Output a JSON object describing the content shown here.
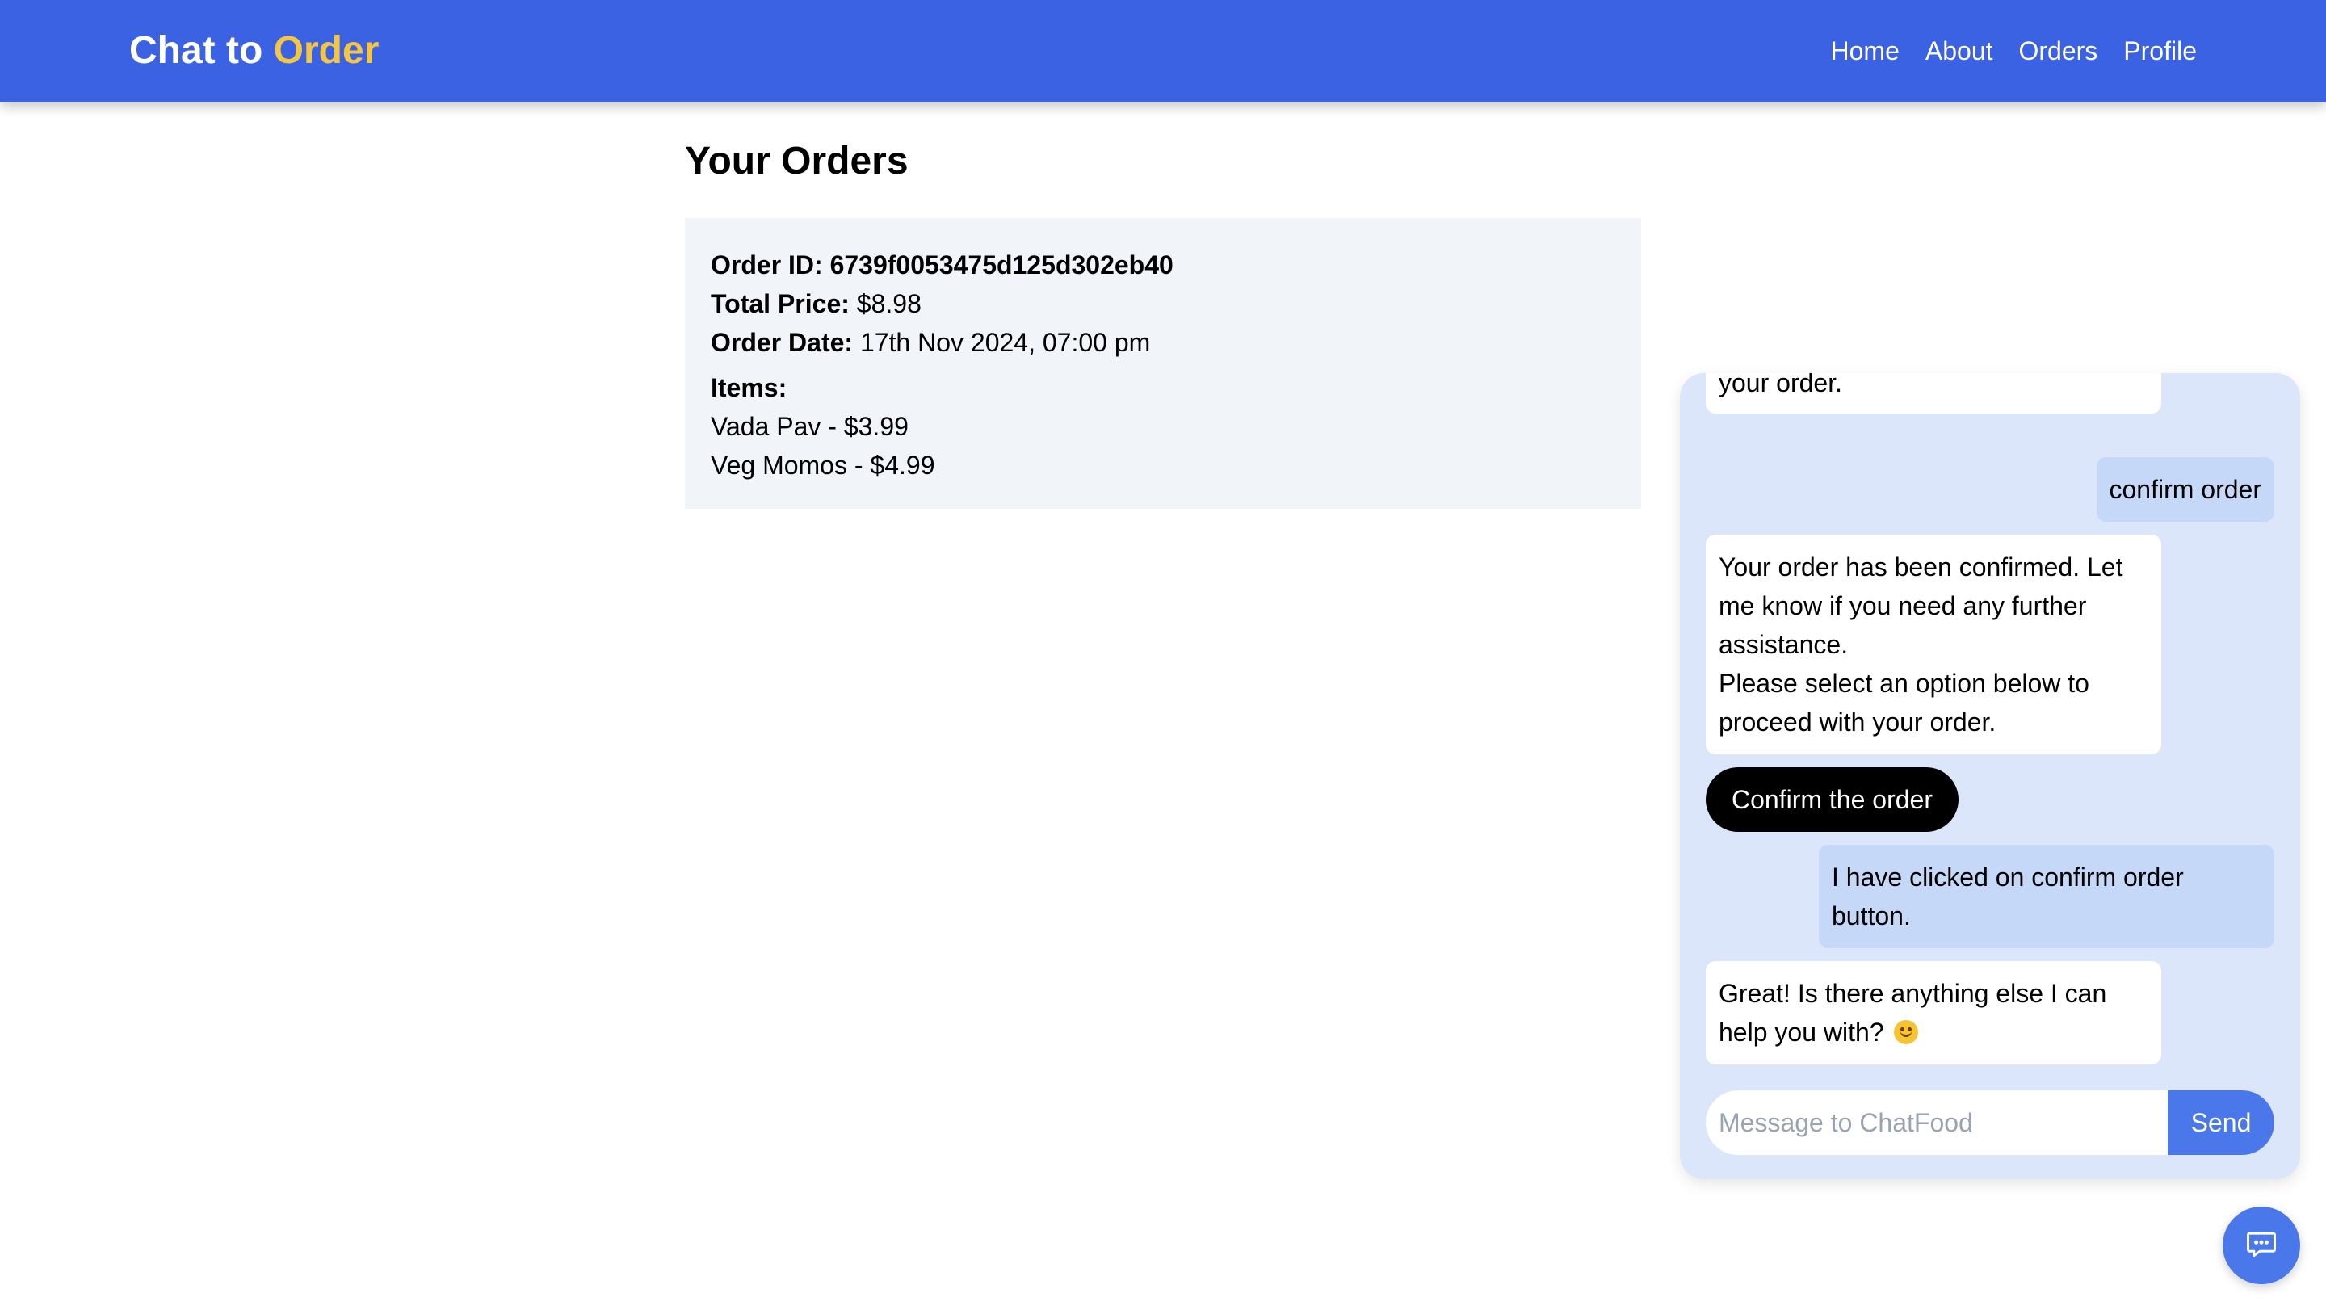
{
  "header": {
    "brand_part1": "Chat to",
    "brand_part2": "Order",
    "nav": {
      "home": "Home",
      "about": "About",
      "orders": "Orders",
      "profile": "Profile"
    }
  },
  "orders": {
    "title": "Your Orders",
    "list": [
      {
        "id_label": "Order ID:",
        "id_value": "6739f0053475d125d302eb40",
        "total_label": "Total Price:",
        "total_value": "$8.98",
        "date_label": "Order Date:",
        "date_value": "17th Nov 2024, 07:00 pm",
        "items_label": "Items:",
        "items": [
          "Vada Pav - $3.99",
          "Veg Momos - $4.99"
        ]
      }
    ]
  },
  "chat": {
    "messages": {
      "partial_bot": "your order.",
      "user_confirm": "confirm order",
      "bot_confirmed_1": "Your order has been confirmed. Let me know if you need any further assistance.",
      "bot_confirmed_2": "Please select an option below to proceed with your order.",
      "user_clicked": "I have clicked on confirm order button.",
      "bot_great": "Great! Is there anything else I can help you with?"
    },
    "option_button": "Confirm the order",
    "input_placeholder": "Message to ChatFood",
    "input_value": "",
    "send_label": "Send"
  },
  "colors": {
    "header_bg": "#3a62e3",
    "brand_accent": "#f4c542",
    "chat_panel_bg": "#dbe6fb",
    "user_bubble": "#c5d8f8",
    "send_button": "#4a78ea"
  },
  "icons": {
    "chat_toggle": "chat-bubble-icon",
    "emoji": "smiling-face-emoji"
  }
}
